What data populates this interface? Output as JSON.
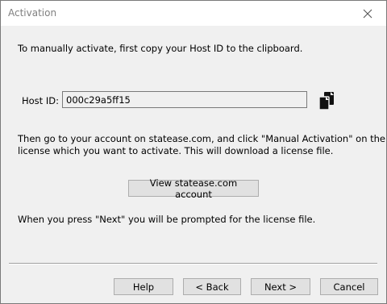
{
  "window": {
    "title": "Activation"
  },
  "instructions": {
    "line1": "To manually activate, first copy your Host ID to the clipboard.",
    "line2a": "Then go to your account on statease.com, and click \"Manual Activation\" on the",
    "line2b": "license which you want to activate. This will download a license file.",
    "line3": "When you press \"Next\" you will be prompted for the license file."
  },
  "host": {
    "label": "Host ID:",
    "value": "000c29a5ff15",
    "copy_icon": "copy-icon"
  },
  "buttons": {
    "view_account": "View statease.com account",
    "help": "Help",
    "back": "< Back",
    "next": "Next >",
    "cancel": "Cancel"
  }
}
